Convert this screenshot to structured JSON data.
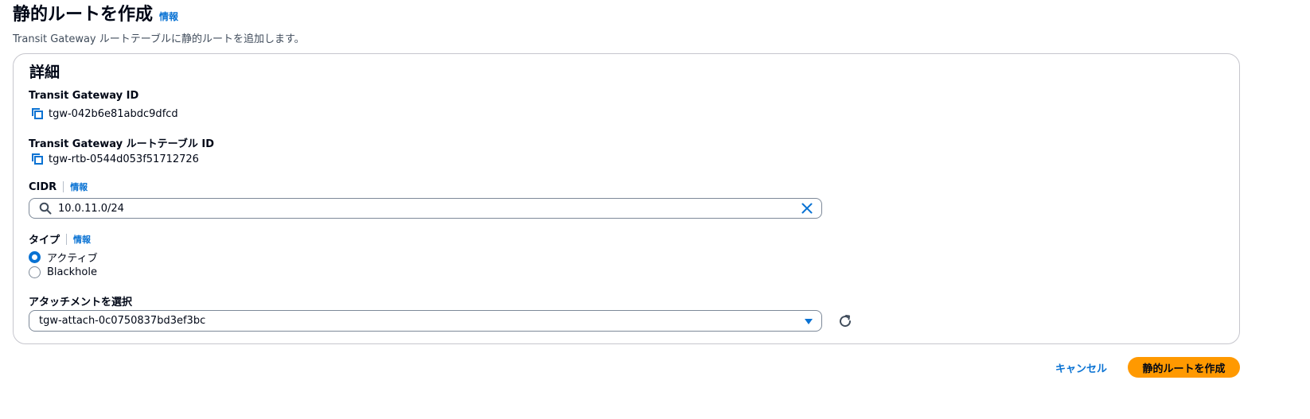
{
  "header": {
    "title": "静的ルートを作成",
    "info_link": "情報",
    "description": "Transit Gateway ルートテーブルに静的ルートを追加します。"
  },
  "details": {
    "title": "詳細",
    "tgw_id": {
      "label": "Transit Gateway ID",
      "value": "tgw-042b6e81abdc9dfcd"
    },
    "rtb_id": {
      "label": "Transit Gateway ルートテーブル ID",
      "value": "tgw-rtb-0544d053f51712726"
    },
    "cidr": {
      "label": "CIDR",
      "info_link": "情報",
      "value": "10.0.11.0/24"
    },
    "type": {
      "label": "タイプ",
      "info_link": "情報",
      "options": [
        {
          "label": "アクティブ",
          "checked": true
        },
        {
          "label": "Blackhole",
          "checked": false
        }
      ]
    },
    "attachment": {
      "label": "アタッチメントを選択",
      "selected": "tgw-attach-0c0750837bd3ef3bc"
    }
  },
  "actions": {
    "cancel": "キャンセル",
    "submit": "静的ルートを作成"
  },
  "colors": {
    "link": "#0972d3",
    "primary": "#ff9900",
    "text": "#000716"
  },
  "icons": {
    "copy": "copy-icon",
    "search": "search-icon",
    "clear": "close-icon",
    "caret": "caret-down-icon",
    "refresh": "refresh-icon"
  }
}
